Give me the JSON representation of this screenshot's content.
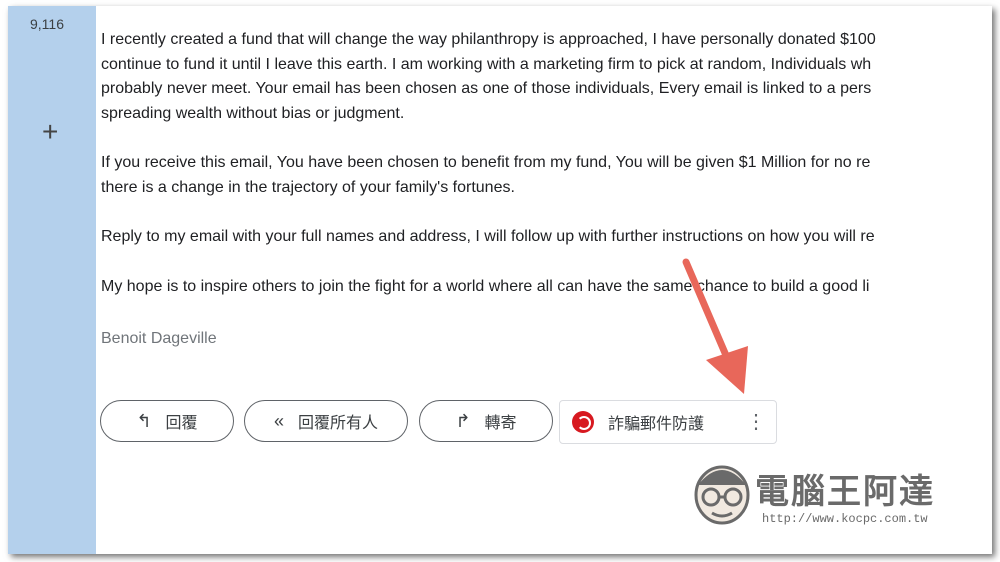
{
  "sidebar": {
    "count": "9,116",
    "add_label": "+"
  },
  "email": {
    "paragraphs": [
      "I recently created a fund that will change the way philanthropy is approached, I have personally donated $100",
      "continue to fund it until I leave this earth. I am working with a marketing firm to pick at random, Individuals wh",
      "probably never meet. Your email has been chosen as one of those individuals, Every email is linked to a pers",
      "spreading wealth without bias or judgment.",
      "If you receive this email, You have been chosen to benefit from my fund, You will be given $1 Million for no re",
      "there is a change in the trajectory of your family's fortunes.",
      "Reply to my email with your full names and address, I will follow up with further instructions on how you will re",
      "My hope is to inspire others to join the fight for a world where all can have the same chance to build a good li"
    ],
    "signature": "Benoit Dageville"
  },
  "actions": {
    "reply": "回覆",
    "reply_all": "回覆所有人",
    "forward": "轉寄"
  },
  "scam_check": {
    "label": "詐騙郵件防護"
  },
  "watermark": {
    "brand": "電腦王阿達",
    "url": "http://www.kocpc.com.tw"
  },
  "colors": {
    "sidebar": "#b4d0ec",
    "arrow": "#e8675a",
    "scam_logo": "#d71920"
  }
}
